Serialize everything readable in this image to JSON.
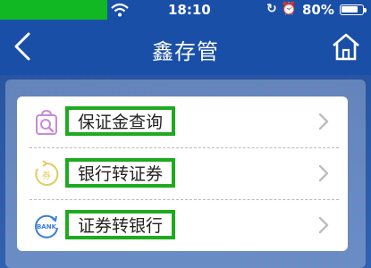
{
  "status_bar": {
    "time": "18:10",
    "battery_percent": "80%",
    "battery_level": 0.8,
    "icons": [
      "wifi-icon",
      "rotation-lock-icon",
      "alarm-icon",
      "battery-icon"
    ]
  },
  "nav": {
    "title": "鑫存管",
    "left_icon": "back-chevron-icon",
    "right_icon": "home-icon"
  },
  "menu": {
    "items": [
      {
        "label": "保证金查询",
        "icon": "bag-search-icon",
        "icon_color": "#c98ad6"
      },
      {
        "label": "银行转证券",
        "icon": "transfer-securities-icon",
        "icon_color": "#e7c95e"
      },
      {
        "label": "证券转银行",
        "icon": "bank-transfer-icon",
        "icon_color": "#3c7ed6"
      }
    ]
  },
  "colors": {
    "nav_bg": "#1a4fa8",
    "highlight_border": "#1eaa1e",
    "carrier_bar": "#11b823"
  }
}
